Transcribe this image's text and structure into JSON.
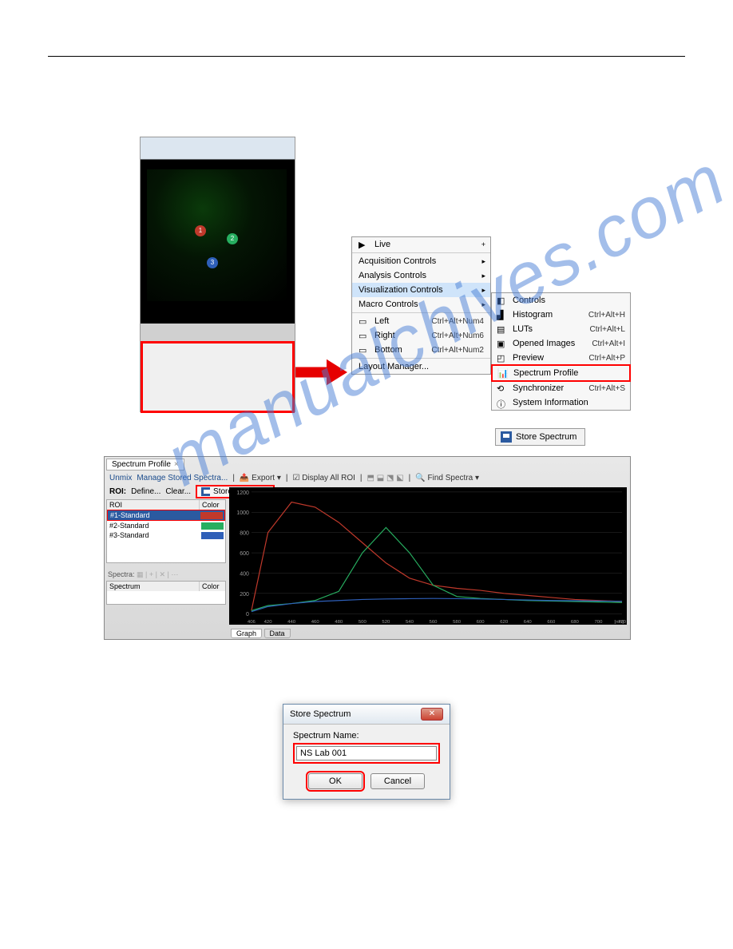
{
  "watermark": "manualchives.com",
  "thumb": {
    "markers": [
      "1",
      "2",
      "3"
    ]
  },
  "menu1": {
    "live": "Live",
    "acq": "Acquisition Controls",
    "ana": "Analysis Controls",
    "viz": "Visualization Controls",
    "macro": "Macro Controls",
    "left": "Left",
    "left_sc": "Ctrl+Alt+Num4",
    "right": "Right",
    "right_sc": "Ctrl+Alt+Num6",
    "bottom": "Bottom",
    "bottom_sc": "Ctrl+Alt+Num2",
    "layout": "Layout Manager..."
  },
  "menu2": {
    "controls": "Controls",
    "histogram": "Histogram",
    "histogram_sc": "Ctrl+Alt+H",
    "luts": "LUTs",
    "luts_sc": "Ctrl+Alt+L",
    "opened": "Opened Images",
    "opened_sc": "Ctrl+Alt+I",
    "preview": "Preview",
    "preview_sc": "Ctrl+Alt+P",
    "spectrum": "Spectrum Profile",
    "sync": "Synchronizer",
    "sync_sc": "Ctrl+Alt+S",
    "sysinfo": "System Information"
  },
  "store_btn": "Store Spectrum",
  "panel": {
    "tab": "Spectrum Profile",
    "toolbar": {
      "unmix": "Unmix",
      "manage": "Manage Stored Spectra...",
      "export": "Export",
      "display_all": "Display All ROI",
      "find": "Find Spectra"
    },
    "roi": {
      "label": "ROI:",
      "define": "Define...",
      "clear": "Clear...",
      "store": "Store Spectrum"
    },
    "list": {
      "hdr_roi": "ROI",
      "hdr_color": "Color",
      "rows": [
        {
          "name": "#1-Standard",
          "color": "#c0392b"
        },
        {
          "name": "#2-Standard",
          "color": "#27ae60"
        },
        {
          "name": "#3-Standard",
          "color": "#2e5fb8"
        }
      ]
    },
    "spectra_label": "Spectra:",
    "spectra_hdr": {
      "spectrum": "Spectrum",
      "color": "Color"
    },
    "tabs": {
      "graph": "Graph",
      "data": "Data"
    }
  },
  "chart_data": {
    "type": "line",
    "xlabel": "[nm]",
    "xlim": [
      406,
      720
    ],
    "ylim": [
      0,
      1200
    ],
    "xticks": [
      406,
      420,
      440,
      460,
      480,
      500,
      520,
      540,
      560,
      580,
      600,
      620,
      640,
      660,
      680,
      700,
      720
    ],
    "yticks": [
      0,
      200,
      400,
      600,
      800,
      1000,
      1200
    ],
    "series": [
      {
        "name": "#1-Standard",
        "color": "#c0392b",
        "x": [
          406,
          420,
          440,
          460,
          480,
          500,
          520,
          540,
          560,
          580,
          600,
          620,
          640,
          660,
          680,
          700,
          720
        ],
        "y": [
          30,
          800,
          1100,
          1050,
          900,
          700,
          500,
          350,
          280,
          250,
          230,
          200,
          180,
          160,
          140,
          130,
          120
        ]
      },
      {
        "name": "#2-Standard",
        "color": "#27ae60",
        "x": [
          406,
          420,
          440,
          460,
          480,
          500,
          520,
          540,
          560,
          580,
          600,
          620,
          640,
          660,
          680,
          700,
          720
        ],
        "y": [
          30,
          80,
          100,
          130,
          220,
          600,
          850,
          600,
          280,
          170,
          150,
          140,
          130,
          125,
          120,
          115,
          110
        ]
      },
      {
        "name": "#3-Standard",
        "color": "#2e5fb8",
        "x": [
          406,
          420,
          440,
          460,
          480,
          500,
          520,
          540,
          560,
          580,
          600,
          620,
          640,
          660,
          680,
          700,
          720
        ],
        "y": [
          20,
          70,
          100,
          120,
          130,
          140,
          145,
          148,
          150,
          148,
          145,
          140,
          135,
          130,
          128,
          125,
          122
        ]
      }
    ]
  },
  "dialog": {
    "title": "Store Spectrum",
    "label": "Spectrum Name:",
    "value": "NS Lab 001",
    "ok": "OK",
    "cancel": "Cancel"
  }
}
